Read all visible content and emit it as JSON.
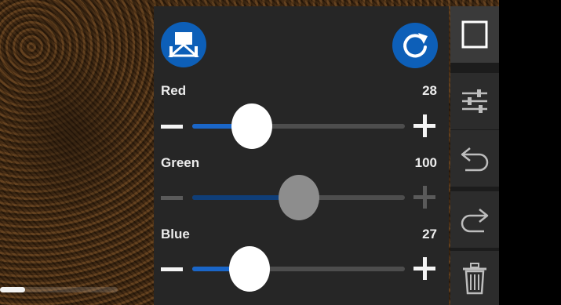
{
  "photo": {
    "description_icon": "photo-background"
  },
  "progress": {
    "fraction": 0.21
  },
  "panel": {
    "left_button_icon": "compare-split-icon",
    "right_button_icon": "reset-refresh-icon",
    "sliders": [
      {
        "label": "Red",
        "value": "28",
        "fraction": 0.28,
        "enabled": true
      },
      {
        "label": "Green",
        "value": "100",
        "fraction": 0.5,
        "enabled": false
      },
      {
        "label": "Blue",
        "value": "27",
        "fraction": 0.27,
        "enabled": true
      }
    ],
    "minus_icon": "minus-icon",
    "plus_icon": "plus-icon"
  },
  "toolbar": {
    "items": [
      {
        "icon": "square-crop-icon",
        "active": true
      },
      {
        "icon": "adjust-sliders-icon",
        "active": false
      },
      {
        "icon": "undo-icon",
        "active": false
      },
      {
        "icon": "redo-icon",
        "active": false
      },
      {
        "icon": "trash-icon",
        "active": false
      }
    ]
  },
  "colors": {
    "accent": "#0d5fb8",
    "slider_fill": "#1a66c8",
    "panel_bg": "#262626",
    "toolbar_bg": "#2c2c2c"
  }
}
